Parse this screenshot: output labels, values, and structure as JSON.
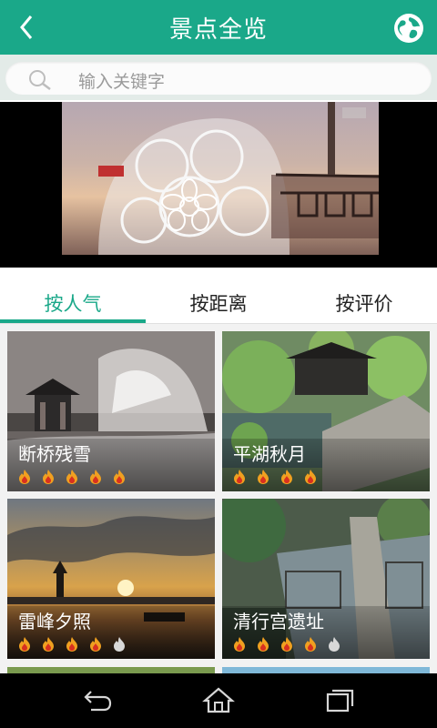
{
  "header": {
    "title": "景点全览",
    "back_icon": "chevron-left-icon",
    "globe_icon": "globe-icon"
  },
  "search": {
    "placeholder": "输入关键字",
    "icon": "search-icon"
  },
  "video": {
    "progress": 0.0
  },
  "tabs": [
    {
      "label": "按人气",
      "active": true
    },
    {
      "label": "按距离",
      "active": false
    },
    {
      "label": "按评价",
      "active": false
    }
  ],
  "spots": [
    {
      "name": "断桥残雪",
      "rating": 5,
      "max_rating": 5
    },
    {
      "name": "平湖秋月",
      "rating": 4,
      "max_rating": 4
    },
    {
      "name": "雷峰夕照",
      "rating": 4,
      "max_rating": 5
    },
    {
      "name": "清行宫遗址",
      "rating": 4,
      "max_rating": 5
    }
  ],
  "colors": {
    "accent": "#1aa889",
    "flame_on": "#f0a020",
    "flame_off": "#d8d8d8"
  },
  "navbar": {
    "icons": [
      "back-icon",
      "home-icon",
      "recent-apps-icon"
    ]
  }
}
